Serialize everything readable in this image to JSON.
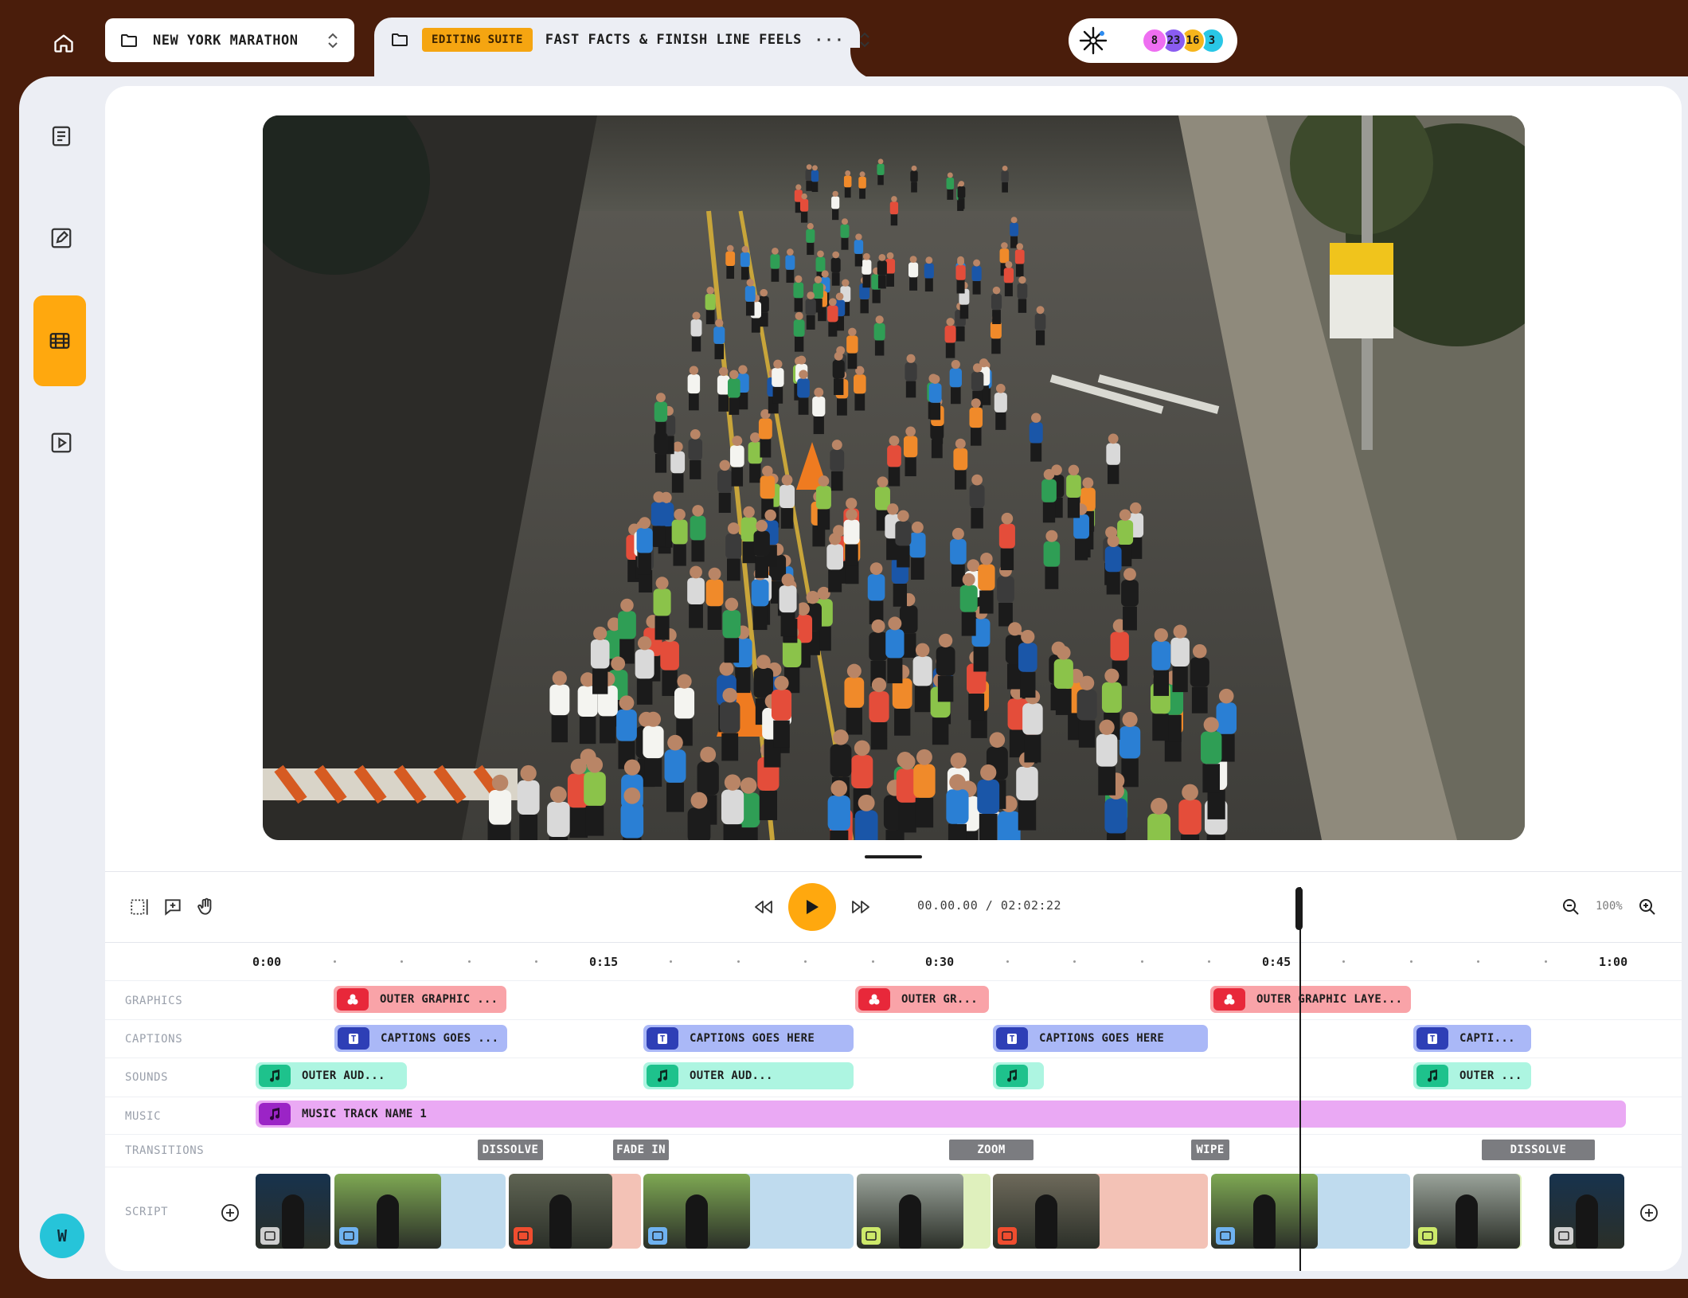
{
  "header": {
    "project_name": "NEW YORK MARATHON",
    "editing_badge": "EDITING SUITE",
    "episode_title": "FAST FACTS & FINISH LINE FEELS",
    "more": "···",
    "collaborators": [
      {
        "count": "8",
        "color": "#ee6ef1"
      },
      {
        "count": "23",
        "color": "#8a5cf0"
      },
      {
        "count": "16",
        "color": "#f6b51c"
      },
      {
        "count": "3",
        "color": "#29c7e6"
      }
    ]
  },
  "sidebar": {
    "items": [
      {
        "name": "script",
        "icon": "document-icon"
      },
      {
        "name": "edit",
        "icon": "pencil-icon"
      },
      {
        "name": "timeline",
        "icon": "film-icon",
        "active": true
      },
      {
        "name": "preview",
        "icon": "play-square-icon"
      }
    ],
    "user_initial": "W"
  },
  "playback": {
    "timecode": "00.00.00 / 02:02:22",
    "zoom": "100%"
  },
  "ruler": {
    "labels": [
      "0:00",
      "0:15",
      "0:30",
      "0:45",
      "1:00"
    ]
  },
  "tracks": {
    "labels": {
      "graphics": "GRAPHICS",
      "captions": "CAPTIONS",
      "sounds": "SOUNDS",
      "music": "MUSIC",
      "transitions": "TRANSITIONS",
      "script": "SCRIPT"
    },
    "graphics": [
      "OUTER GRAPHIC ...",
      "OUTER GR...",
      "OUTER GRAPHIC LAYE..."
    ],
    "captions": [
      "CAPTIONS GOES ...",
      "CAPTIONS GOES HERE",
      "CAPTIONS GOES HERE",
      "CAPTI..."
    ],
    "sounds": [
      "OUTER AUD...",
      "OUTER AUD...",
      "",
      "OUTER ..."
    ],
    "music": [
      "MUSIC TRACK NAME 1"
    ],
    "transitions": [
      "DISSOLVE",
      "FADE IN",
      "ZOOM",
      "WIPE",
      "DISSOLVE"
    ]
  },
  "colors": {
    "accent": "#ffa80e",
    "background": "#4a1d0b",
    "graphics": "#e8283a",
    "captions": "#2e3fb6",
    "sounds": "#1ec28c",
    "music": "#9b24c6"
  }
}
